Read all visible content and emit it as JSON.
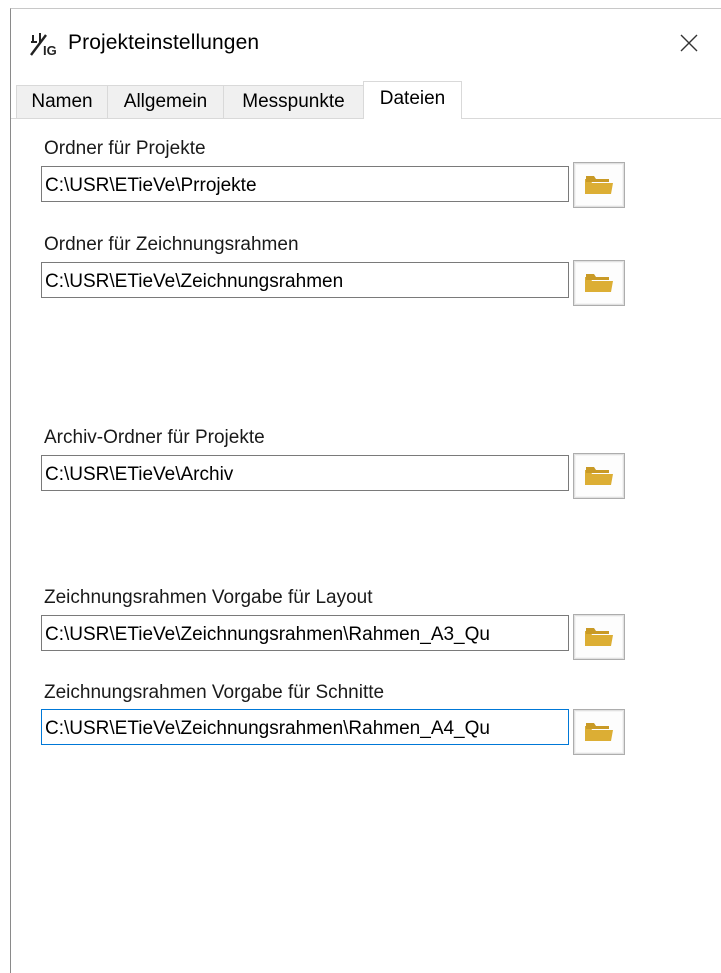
{
  "window": {
    "title": "Projekteinstellungen",
    "icon": "jvg-app-icon"
  },
  "tabs": [
    {
      "label": "Namen",
      "active": false
    },
    {
      "label": "Allgemein",
      "active": false
    },
    {
      "label": "Messpunkte",
      "active": false
    },
    {
      "label": "Dateien",
      "active": true
    }
  ],
  "fields": [
    {
      "label": "Ordner für Projekte",
      "value": "C:\\USR\\ETieVe\\Prrojekte"
    },
    {
      "label": "Ordner für Zeichnungsrahmen",
      "value": "C:\\USR\\ETieVe\\Zeichnungsrahmen"
    },
    {
      "label": "Archiv-Ordner für Projekte",
      "value": "C:\\USR\\ETieVe\\Archiv"
    },
    {
      "label": "Zeichnungsrahmen Vorgabe  für Layout",
      "value": "C:\\USR\\ETieVe\\Zeichnungsrahmen\\Rahmen_A3_Qu"
    },
    {
      "label": "Zeichnungsrahmen Vorgabe für Schnitte",
      "value": "C:\\USR\\ETieVe\\Zeichnungsrahmen\\Rahmen_A4_Qu"
    }
  ],
  "colors": {
    "focus_border": "#0078d7",
    "folder_icon": "#e0b53a"
  },
  "icons": {
    "close": "close-icon",
    "browse": "folder-icon"
  }
}
